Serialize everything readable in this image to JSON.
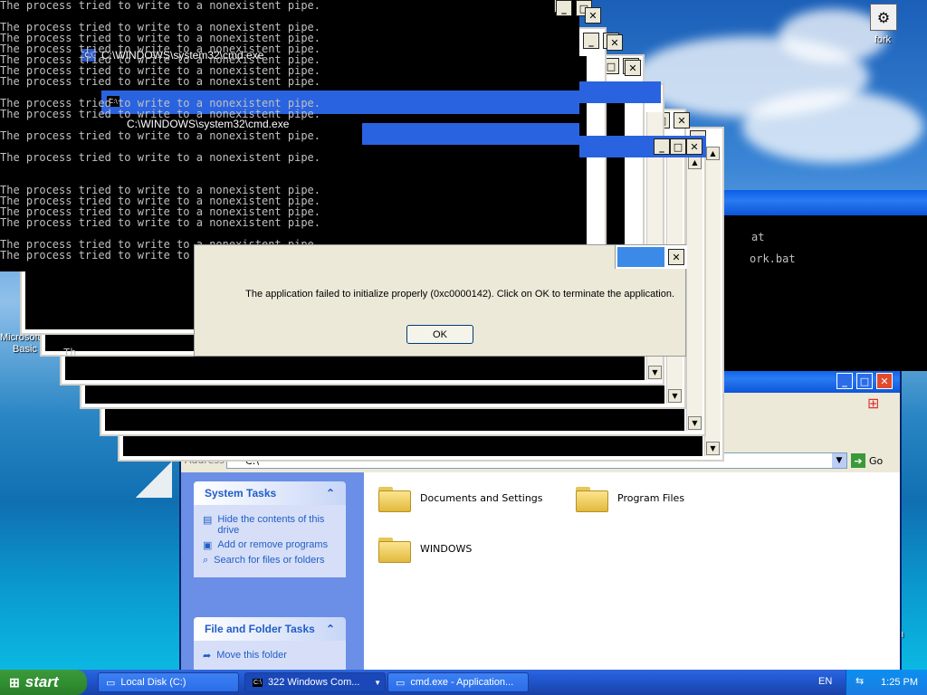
{
  "desktop": {
    "icons": [
      {
        "label": "fork"
      }
    ],
    "partial_labels": {
      "left_icon_1": "Microsoft",
      "left_icon_2": "Basic",
      "right_fragment": "n"
    }
  },
  "cmd_window": {
    "title": "C:\\WINDOWS\\system32\\cmd.exe",
    "line": "The process tried to write to a nonexistent pipe."
  },
  "cmd_fragments": {
    "bat1": "at",
    "bat2": "ork.bat",
    "th": "Th"
  },
  "dialog": {
    "message": "The application failed to initialize properly (0xc0000142). Click on OK to terminate the application.",
    "ok_label": "OK"
  },
  "explorer": {
    "address_label": "Address",
    "address_value": "C:\\",
    "go_label": "Go",
    "system_tasks": {
      "title": "System Tasks",
      "items": [
        {
          "label": "Hide the contents of this drive"
        },
        {
          "label": "Add or remove programs"
        },
        {
          "label": "Search for files or folders"
        }
      ]
    },
    "file_tasks": {
      "title": "File and Folder Tasks",
      "items": [
        {
          "label": "Move this folder"
        }
      ]
    },
    "folders": [
      {
        "name": "Documents and Settings"
      },
      {
        "name": "Program Files"
      },
      {
        "name": "WINDOWS"
      }
    ]
  },
  "taskbar": {
    "start_label": "start",
    "tasks": [
      {
        "label": "Local Disk (C:)"
      },
      {
        "label": "322 Windows Com..."
      },
      {
        "label": "cmd.exe - Application..."
      }
    ],
    "language": "EN",
    "clock": "1:25 PM"
  }
}
